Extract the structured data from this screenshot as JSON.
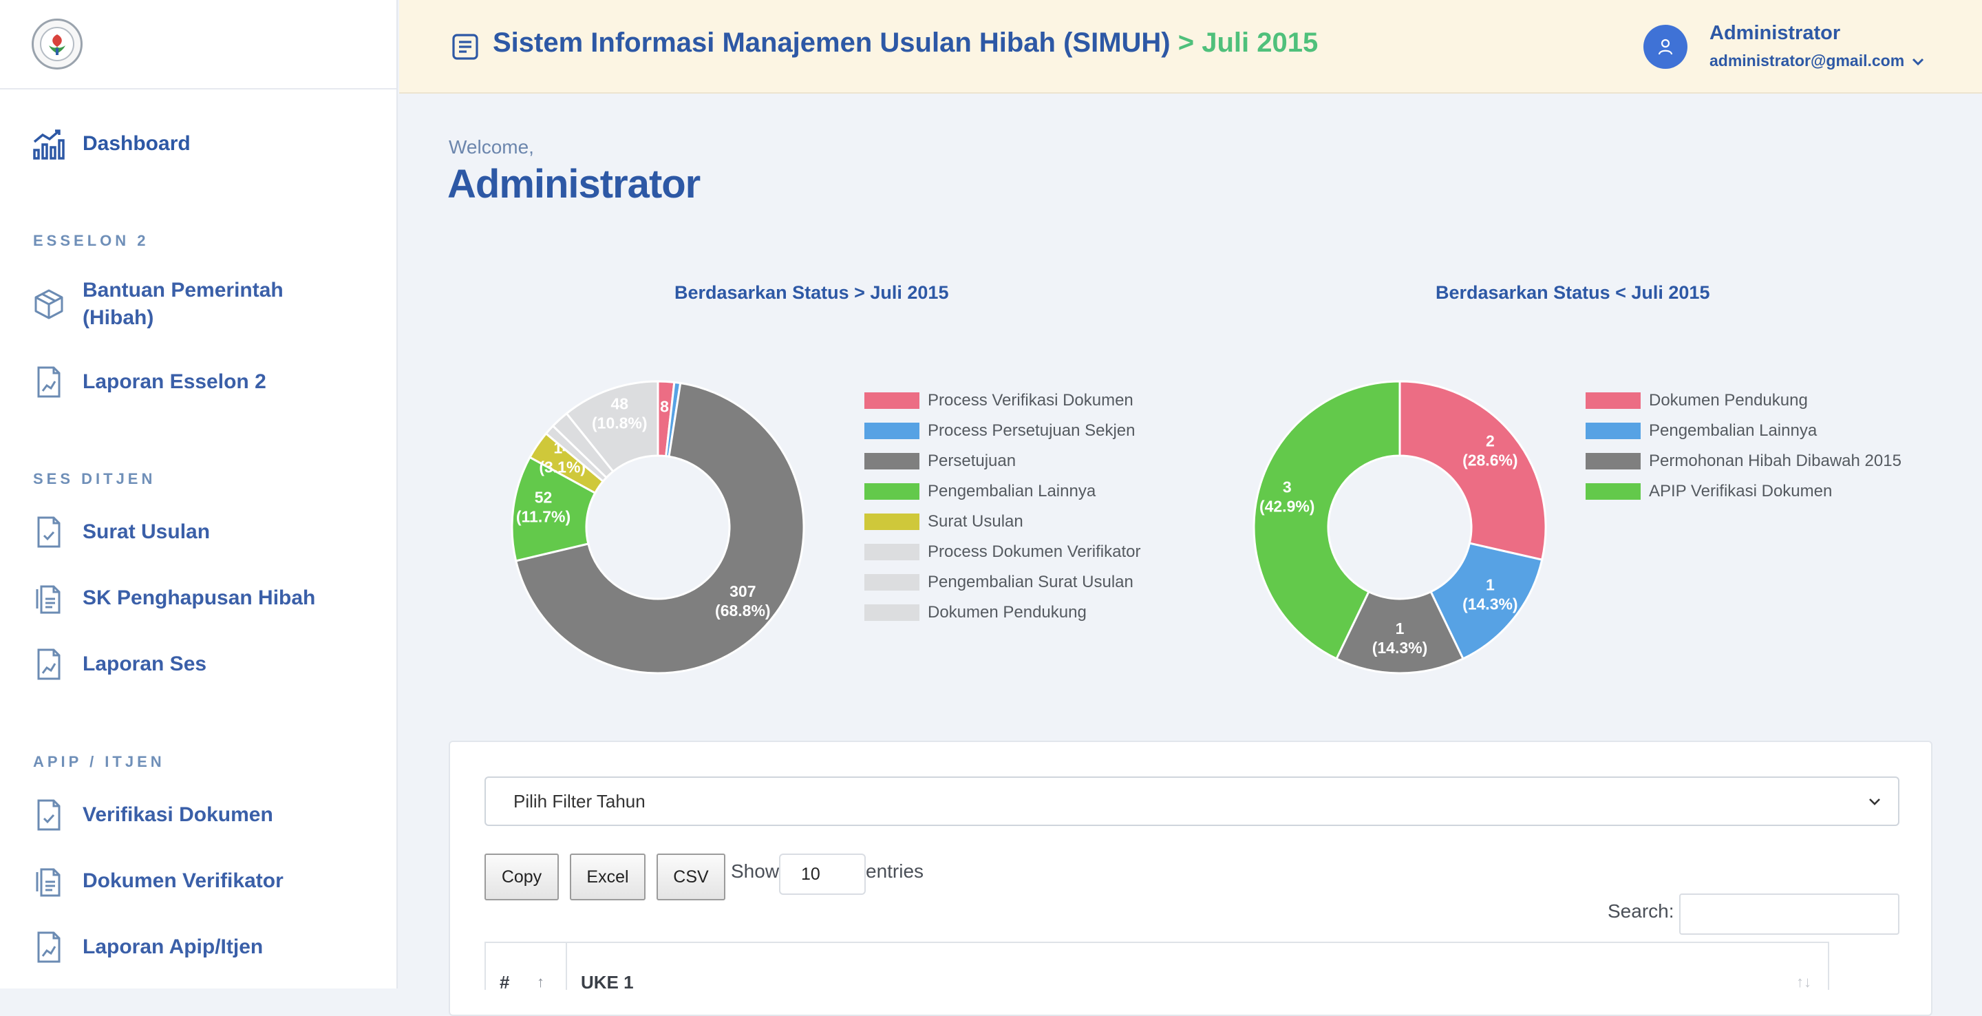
{
  "sidebar": {
    "dashboard": "Dashboard",
    "sections": [
      {
        "title": "ESSELON 2",
        "items": [
          "Bantuan Pemerintah (Hibah)",
          "Laporan Esselon 2"
        ]
      },
      {
        "title": "SES DITJEN",
        "items": [
          "Surat Usulan",
          "SK Penghapusan Hibah",
          "Laporan Ses"
        ]
      },
      {
        "title": "APIP / ITJEN",
        "items": [
          "Verifikasi Dokumen",
          "Dokumen Verifikator",
          "Laporan Apip/Itjen"
        ]
      }
    ],
    "item_1_line1": "Bantuan Pemerintah",
    "item_1_line2": "(Hibah)"
  },
  "header": {
    "title": "Sistem Informasi Manajemen Usulan Hibah (SIMUH)",
    "subtitle": "> Juli 2015",
    "user_name": "Administrator",
    "user_email": "administrator@gmail.com"
  },
  "main": {
    "welcome": "Welcome,",
    "user_title": "Administrator"
  },
  "chart_data": [
    {
      "type": "pie",
      "donut": true,
      "title": "Berdasarkan Status > Juli 2015",
      "labels": [
        "Process Verifikasi Dokumen",
        "Process Persetujuan Sekjen",
        "Persetujuan",
        "Pengembalian Lainnya",
        "Surat Usulan",
        "Process Dokumen Verifikator",
        "Pengembalian Surat Usulan",
        "Dokumen Pendukung"
      ],
      "values": [
        8,
        3,
        307,
        52,
        14,
        5,
        9,
        48
      ],
      "data_labels": [
        "8",
        "",
        "307\n(68.8%)",
        "52\n(11.7%)",
        "14\n(3.1%)",
        "",
        "",
        "48\n(10.8%)"
      ],
      "colors": [
        "#ec6d84",
        "#57a2e4",
        "#7f7f7f",
        "#63c94b",
        "#cfc83a",
        "#dcdddf",
        "#dcdddf",
        "#dcdddf"
      ],
      "legend": "right"
    },
    {
      "type": "pie",
      "donut": true,
      "title": "Berdasarkan Status < Juli 2015",
      "labels": [
        "Dokumen Pendukung",
        "Pengembalian Lainnya",
        "Permohonan Hibah Dibawah 2015",
        "APIP Verifikasi Dokumen"
      ],
      "values": [
        2,
        1,
        1,
        3
      ],
      "data_labels": [
        "2\n(28.6%)",
        "1\n(14.3%)",
        "1\n(14.3%)",
        "3\n(42.9%)"
      ],
      "colors": [
        "#ec6d84",
        "#57a2e4",
        "#7f7f7f",
        "#63c94b"
      ],
      "legend": "right"
    }
  ],
  "table": {
    "filter_placeholder": "Pilih Filter Tahun",
    "buttons": [
      "Copy",
      "Excel",
      "CSV"
    ],
    "show_label": "Show",
    "entries_value": "10",
    "entries_label": "entries",
    "search_label": "Search:",
    "columns": [
      "#",
      "UKE 1"
    ]
  }
}
